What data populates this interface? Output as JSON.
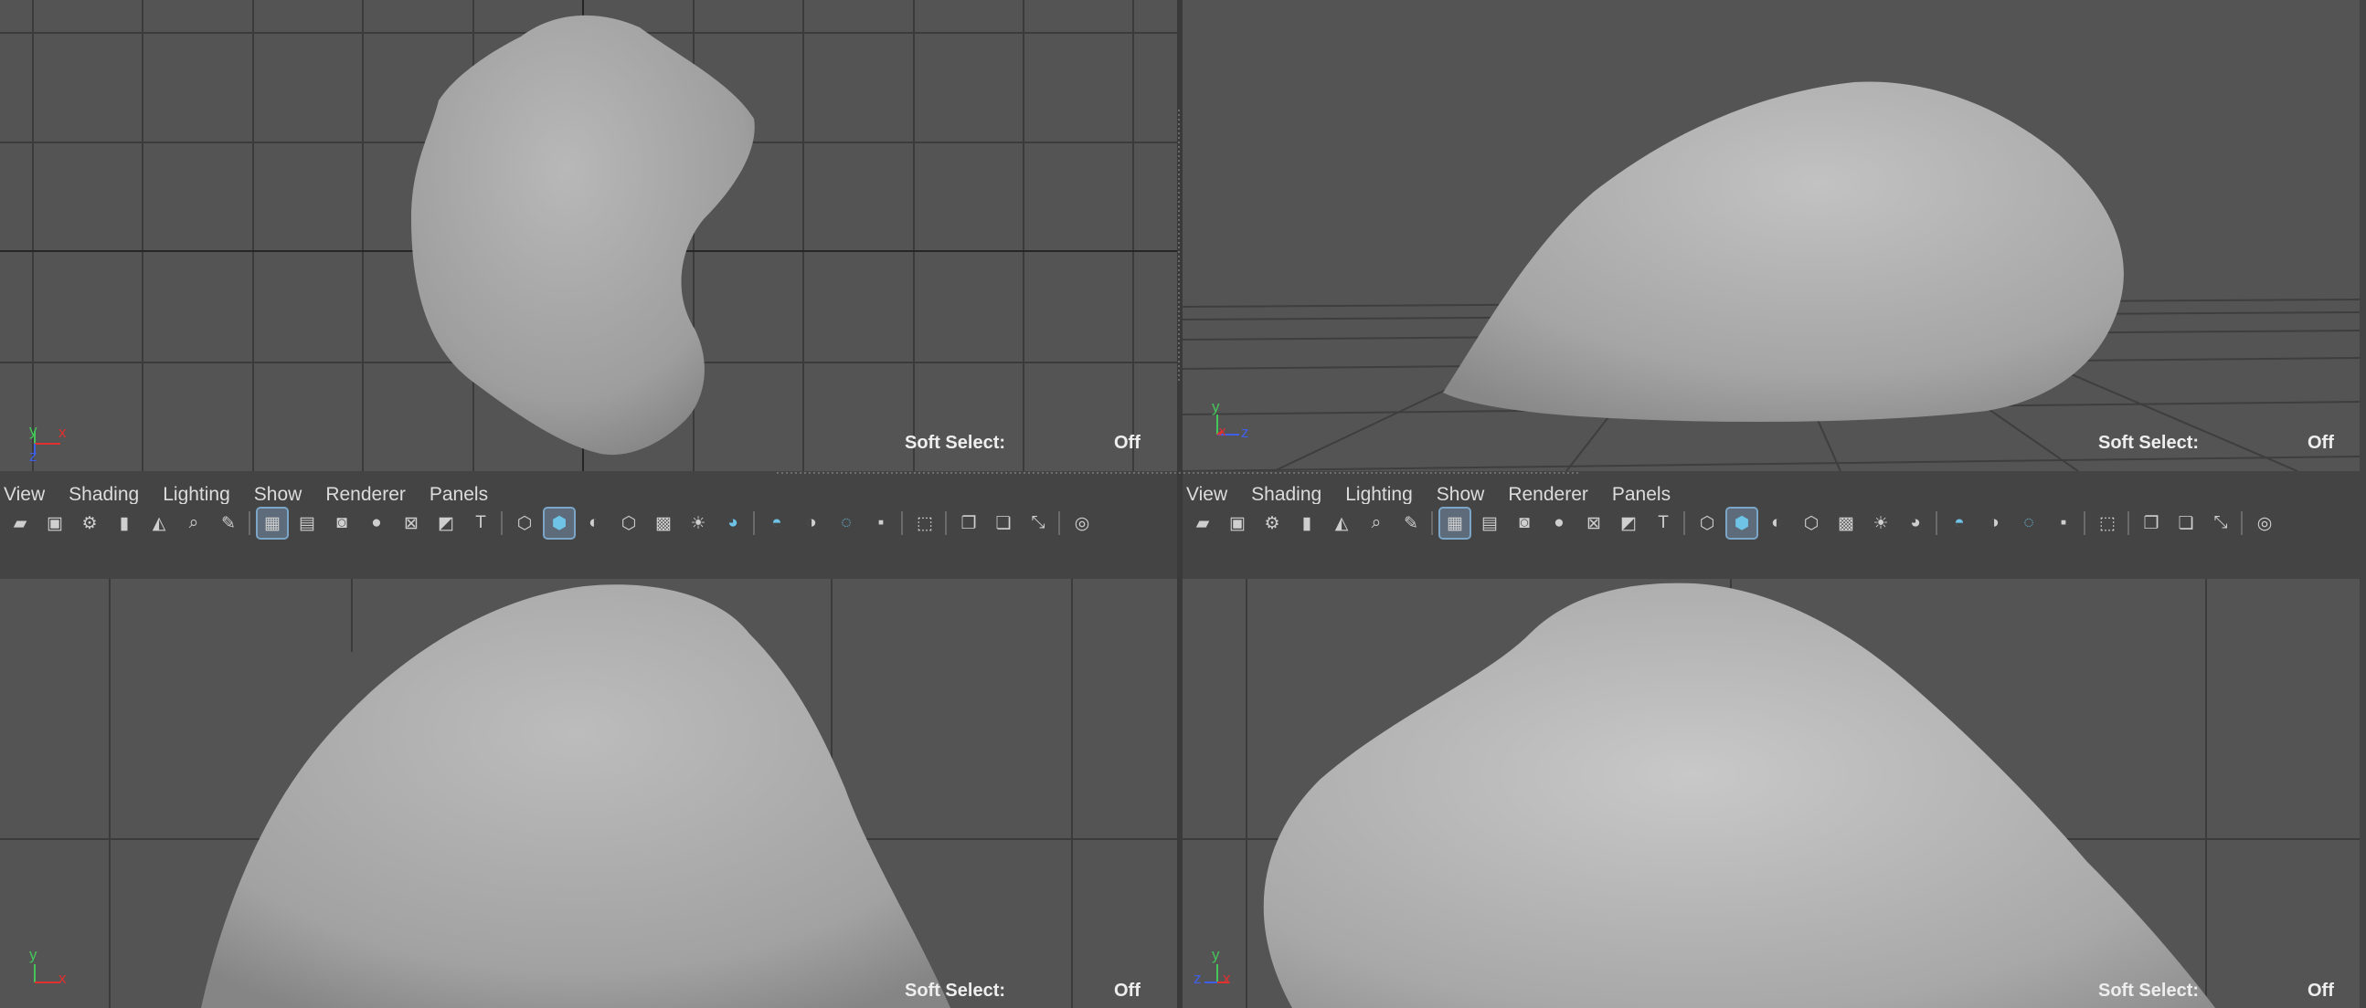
{
  "panels": [
    {
      "id": "tl",
      "soft_select_label": "Soft Select:",
      "soft_select_value": "Off",
      "axis": {
        "a": "y",
        "b": "x",
        "c": "z"
      }
    },
    {
      "id": "tr",
      "soft_select_label": "Soft Select:",
      "soft_select_value": "Off",
      "axis": {
        "a": "y",
        "b": "x",
        "c": "z"
      }
    },
    {
      "id": "bl",
      "soft_select_label": "Soft Select:",
      "soft_select_value": "Off",
      "axis": {
        "a": "y",
        "b": "x"
      },
      "menu": [
        "View",
        "Shading",
        "Lighting",
        "Show",
        "Renderer",
        "Panels"
      ]
    },
    {
      "id": "br",
      "soft_select_label": "Soft Select:",
      "soft_select_value": "Off",
      "axis": {
        "a": "y",
        "b": "z",
        "c": "x"
      },
      "menu": [
        "View",
        "Shading",
        "Lighting",
        "Show",
        "Renderer",
        "Panels"
      ]
    }
  ],
  "toolbar_icons": [
    "camera-icon",
    "lock-camera-icon",
    "camera-attributes-icon",
    "bookmark-icon",
    "image-plane-icon",
    "zoom-icon",
    "paint-icon",
    "grid-icon",
    "film-gate-icon",
    "resolution-gate-icon",
    "gate-mask-icon",
    "field-chart-icon",
    "safe-action-icon",
    "safe-title-icon",
    "wireframe-icon",
    "smooth-shade-icon",
    "default-material-icon",
    "wireframe-on-shaded-icon",
    "textured-icon",
    "lights-icon",
    "shadows-icon",
    "ambient-occlusion-icon",
    "motion-blur-icon",
    "anti-aliasing-icon",
    "depth-of-field-icon",
    "isolate-select-icon",
    "xray-icon",
    "xray-joints-icon",
    "xray-components-icon",
    "exposure-icon"
  ],
  "colors": {
    "viewport_bg": "#545454",
    "chrome": "#444444",
    "grid": "#3b3b3b",
    "mesh": "#a9a9a9",
    "axis_x": "#e0312e",
    "axis_y": "#45c45a",
    "axis_z": "#3f5fe8",
    "active_icon": "#6ec3e6"
  }
}
